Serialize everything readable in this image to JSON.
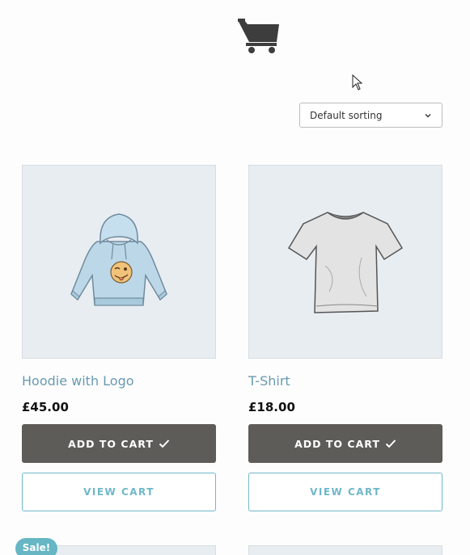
{
  "header": {
    "logo_icon": "shopping-cart-icon"
  },
  "sorting": {
    "selected": "Default sorting"
  },
  "products": [
    {
      "title": "Hoodie with Logo",
      "price": "£45.00",
      "add_to_cart_label": "ADD TO CART",
      "view_cart_label": "VIEW CART",
      "image_icon": "hoodie-image"
    },
    {
      "title": "T-Shirt",
      "price": "£18.00",
      "add_to_cart_label": "ADD TO CART",
      "view_cart_label": "VIEW CART",
      "image_icon": "tshirt-image"
    }
  ],
  "next_row": {
    "sale_badge": "Sale!"
  },
  "colors": {
    "accent": "#6fb8c8",
    "title_link": "#6a9ab0",
    "button_dark": "#5e5c59",
    "thumb_bg": "#e8edf2"
  }
}
